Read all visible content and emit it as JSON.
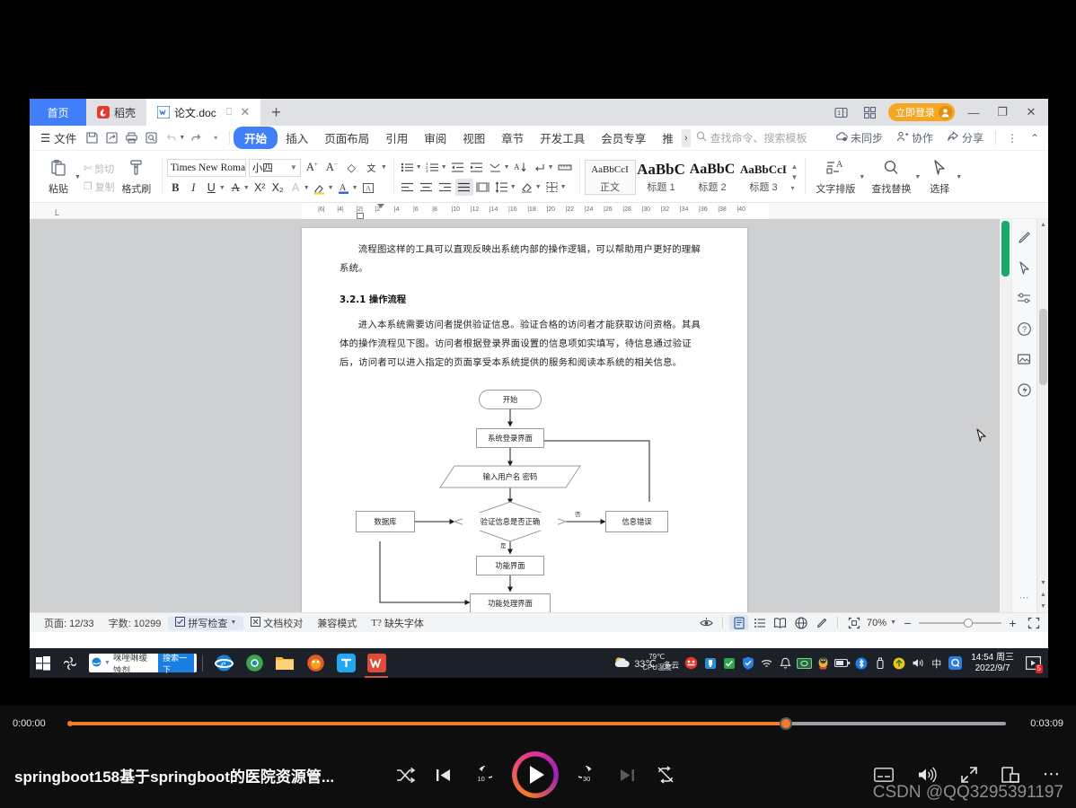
{
  "window": {
    "tabs": [
      {
        "label": "首页",
        "icon": "home-icon"
      },
      {
        "label": "稻壳",
        "icon": "docer-icon"
      },
      {
        "label": "论文.doc",
        "icon": "wps-doc-icon"
      }
    ],
    "new_tab": "+",
    "login_label": "立即登录",
    "controls": {
      "minimize": "—",
      "restore": "❐",
      "close": "✕"
    }
  },
  "menubar": {
    "file": "文件",
    "quick": [
      "save-icon",
      "save-as-icon",
      "print-icon",
      "print-preview-icon",
      "undo-icon",
      "redo-icon",
      "customize-icon"
    ],
    "tabs": [
      "开始",
      "插入",
      "页面布局",
      "引用",
      "审阅",
      "视图",
      "章节",
      "开发工具",
      "会员专享",
      "推"
    ],
    "selected_tab": "开始",
    "more": "›",
    "search_placeholder": "查找命令、搜索模板",
    "right": [
      {
        "label": "未同步",
        "icon": "cloud-sync-icon"
      },
      {
        "label": "协作",
        "icon": "collaborate-icon"
      },
      {
        "label": "分享",
        "icon": "share-icon"
      }
    ],
    "overflow": "⋮",
    "collapse": "⌃"
  },
  "ribbon": {
    "clipboard": {
      "paste": "粘贴",
      "cut": "剪切",
      "copy": "复制",
      "format_painter": "格式刷"
    },
    "font": {
      "name": "Times New Roma",
      "size": "小四",
      "grow": "A",
      "shrink": "A",
      "bold": "B",
      "italic": "I",
      "underline": "U",
      "strikethrough": "A",
      "superscript": "X²",
      "subscript": "X₂",
      "text_effect": "A",
      "highlight": "A",
      "font_color": "A",
      "clear_format": "◇",
      "pinyin": "文",
      "char_border": "A"
    },
    "paragraph": {
      "bullets": "≡",
      "numbering": "≡",
      "decrease_indent": "⇤",
      "increase_indent": "⇥",
      "sort_chinese": "⌃",
      "sort": "A↓",
      "show_marks": "↵",
      "ruler": "▦",
      "align_left": "≡",
      "align_center": "≡",
      "align_right": "≡",
      "align_justify": "≡",
      "distribute": "▤",
      "line_spacing": "↕",
      "shading": "◈",
      "borders": "⊞"
    },
    "styles": {
      "items": [
        {
          "preview": "AaBbCcI",
          "name": "正文",
          "selected": true,
          "size": "11px"
        },
        {
          "preview": "AaBbC",
          "name": "标题 1",
          "selected": false,
          "size": "17px"
        },
        {
          "preview": "AaBbC",
          "name": "标题 2",
          "selected": false,
          "size": "15px"
        },
        {
          "preview": "AaBbCcI",
          "name": "标题 3",
          "selected": false,
          "size": "12px"
        }
      ],
      "scroll_up": "▲",
      "scroll_down": "▼",
      "expand": "▾"
    },
    "tools": [
      {
        "label": "文字排版",
        "icon": "text-layout-icon"
      },
      {
        "label": "查找替换",
        "icon": "search-icon"
      },
      {
        "label": "选择",
        "icon": "cursor-select-icon"
      }
    ]
  },
  "ruler": {
    "marks": [
      "6",
      "4",
      "2",
      "2",
      "4",
      "6",
      "8",
      "10",
      "12",
      "14",
      "16",
      "18",
      "20",
      "22",
      "24",
      "26",
      "28",
      "30",
      "32",
      "34",
      "36",
      "38",
      "40"
    ]
  },
  "document": {
    "paragraphs": [
      "流程图这样的工具可以直观反映出系统内部的操作逻辑，可以帮助用户更好的理解系统。",
      "进入本系统需要访问者提供验证信息。验证合格的访问者才能获取访问资格。其具体的操作流程见下图。访问者根据登录界面设置的信息项如实填写，待信息通过验证后，访问者可以进入指定的页面享受本系统提供的服务和阅读本系统的相关信息。"
    ],
    "heading": "3.2.1 操作流程",
    "flowchart": {
      "nodes": [
        {
          "id": "start",
          "label": "开始",
          "shape": "terminator"
        },
        {
          "id": "login",
          "label": "系统登录界面",
          "shape": "process"
        },
        {
          "id": "input",
          "label": "输入用户名 密码",
          "shape": "parallelogram"
        },
        {
          "id": "db",
          "label": "数据库",
          "shape": "process"
        },
        {
          "id": "verify",
          "label": "验证信息是否正确",
          "shape": "decision"
        },
        {
          "id": "error",
          "label": "信息错误",
          "shape": "process"
        },
        {
          "id": "func",
          "label": "功能界面",
          "shape": "process"
        },
        {
          "id": "process",
          "label": "功能处理界面",
          "shape": "process"
        }
      ],
      "edge_labels": [
        {
          "text": "否",
          "from": "verify",
          "to": "error"
        },
        {
          "text": "是",
          "from": "verify",
          "to": "func"
        }
      ]
    }
  },
  "statusbar": {
    "page": "页面: 12/33",
    "words": "字数: 10299",
    "spellcheck": "拼写检查",
    "proofread": "文档校对",
    "compat": "兼容模式",
    "missing_font": "缺失字体",
    "view_icons": [
      "eye-icon",
      "page-view-icon",
      "outline-view-icon",
      "read-view-icon",
      "web-view-icon",
      "edit-pen-icon",
      "fit-page-icon"
    ],
    "zoom_level": "70%",
    "zoom_out": "−",
    "zoom_in": "+",
    "fullscreen": "⛶"
  },
  "taskbar": {
    "start": "windows-logo-icon",
    "cortana": "cortana-icon",
    "search_value": "咪唑啉缓蚀剂",
    "search_button": "搜索一下",
    "apps": [
      "ie-icon",
      "chrome-icon",
      "file-explorer-icon",
      "firefox-icon",
      "tim-icon",
      "wps-icon"
    ],
    "weather": {
      "temp": "33℃",
      "cpu_temp": "79℃",
      "cpu_label": "CPU温度",
      "desc": "多云"
    },
    "tray": [
      "shield-red-icon",
      "usb-icon",
      "360-icon",
      "tencent-shield-icon",
      "wifi-icon",
      "bell-icon",
      "money-icon",
      "qq-icon",
      "battery-icon",
      "bluetooth-icon",
      "usb2-icon",
      "update-icon",
      "volume-icon",
      "ime-cn-icon",
      "q-icon"
    ],
    "ime": "中",
    "clock_time": "14:54 周三",
    "clock_date": "2022/9/7",
    "notify_badge": "5"
  },
  "player": {
    "current_time": "0:00:00",
    "total_time": "0:03:09",
    "progress_percent": 76.5,
    "title": "springboot158基于springboot的医院资源管...",
    "controls": {
      "shuffle": "shuffle-icon",
      "previous": "previous-track-icon",
      "rewind": "rewind-10-icon",
      "rewind_label": "10",
      "play": "play-icon",
      "forward": "forward-30-icon",
      "forward_label": "30",
      "next": "next-track-icon",
      "repeat_off": "repeat-off-icon",
      "captions": "captions-icon",
      "volume": "volume-icon",
      "fullscreen": "fullscreen-icon",
      "miniplayer": "miniplayer-icon",
      "more": "more-options-icon"
    }
  },
  "watermark": "CSDN @QQ3295391197"
}
